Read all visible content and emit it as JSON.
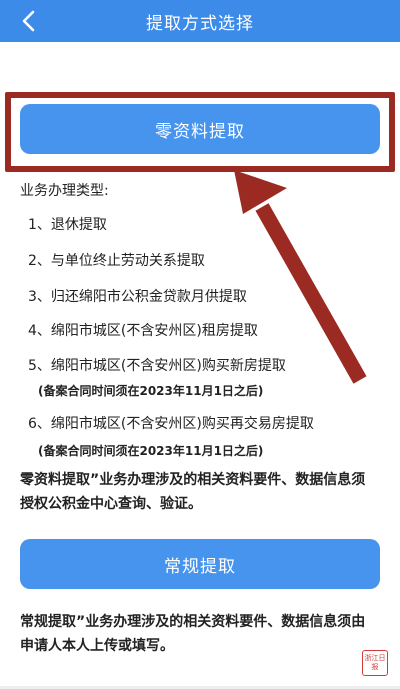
{
  "header": {
    "title": "提取方式选择",
    "background": "#3d8be8"
  },
  "buttons": {
    "zero_docs": "零资料提取",
    "regular": "常规提取"
  },
  "business": {
    "label": "业务办理类型:",
    "items": [
      "1、退休提取",
      "2、与单位终止劳动关系提取",
      "3、归还绵阳市公积金贷款月供提取",
      "4、绵阳市城区(不含安州区)租房提取",
      "5、绵阳市城区(不含安州区)购买新房提取",
      "6、绵阳市城区(不含安州区)购买再交易房提取"
    ],
    "notes": [
      "(备案合同时间须在2023年11月1日之后)",
      "(备案合同时间须在2023年11月1日之后)"
    ]
  },
  "descriptions": {
    "zero_docs": "零资料提取”业务办理涉及的相关资料要件、数据信息须授权公积金中心查询、验证。",
    "regular": "常规提取”业务办理涉及的相关资料要件、数据信息须由申请人本人上传或填写。"
  },
  "watermark": {
    "text": "浙江日报"
  },
  "colors": {
    "button": "#4794ef",
    "highlight": "#9b2a22"
  },
  "icons": {
    "back": "chevron-left-icon",
    "annotation": "arrow-annotation-icon"
  }
}
